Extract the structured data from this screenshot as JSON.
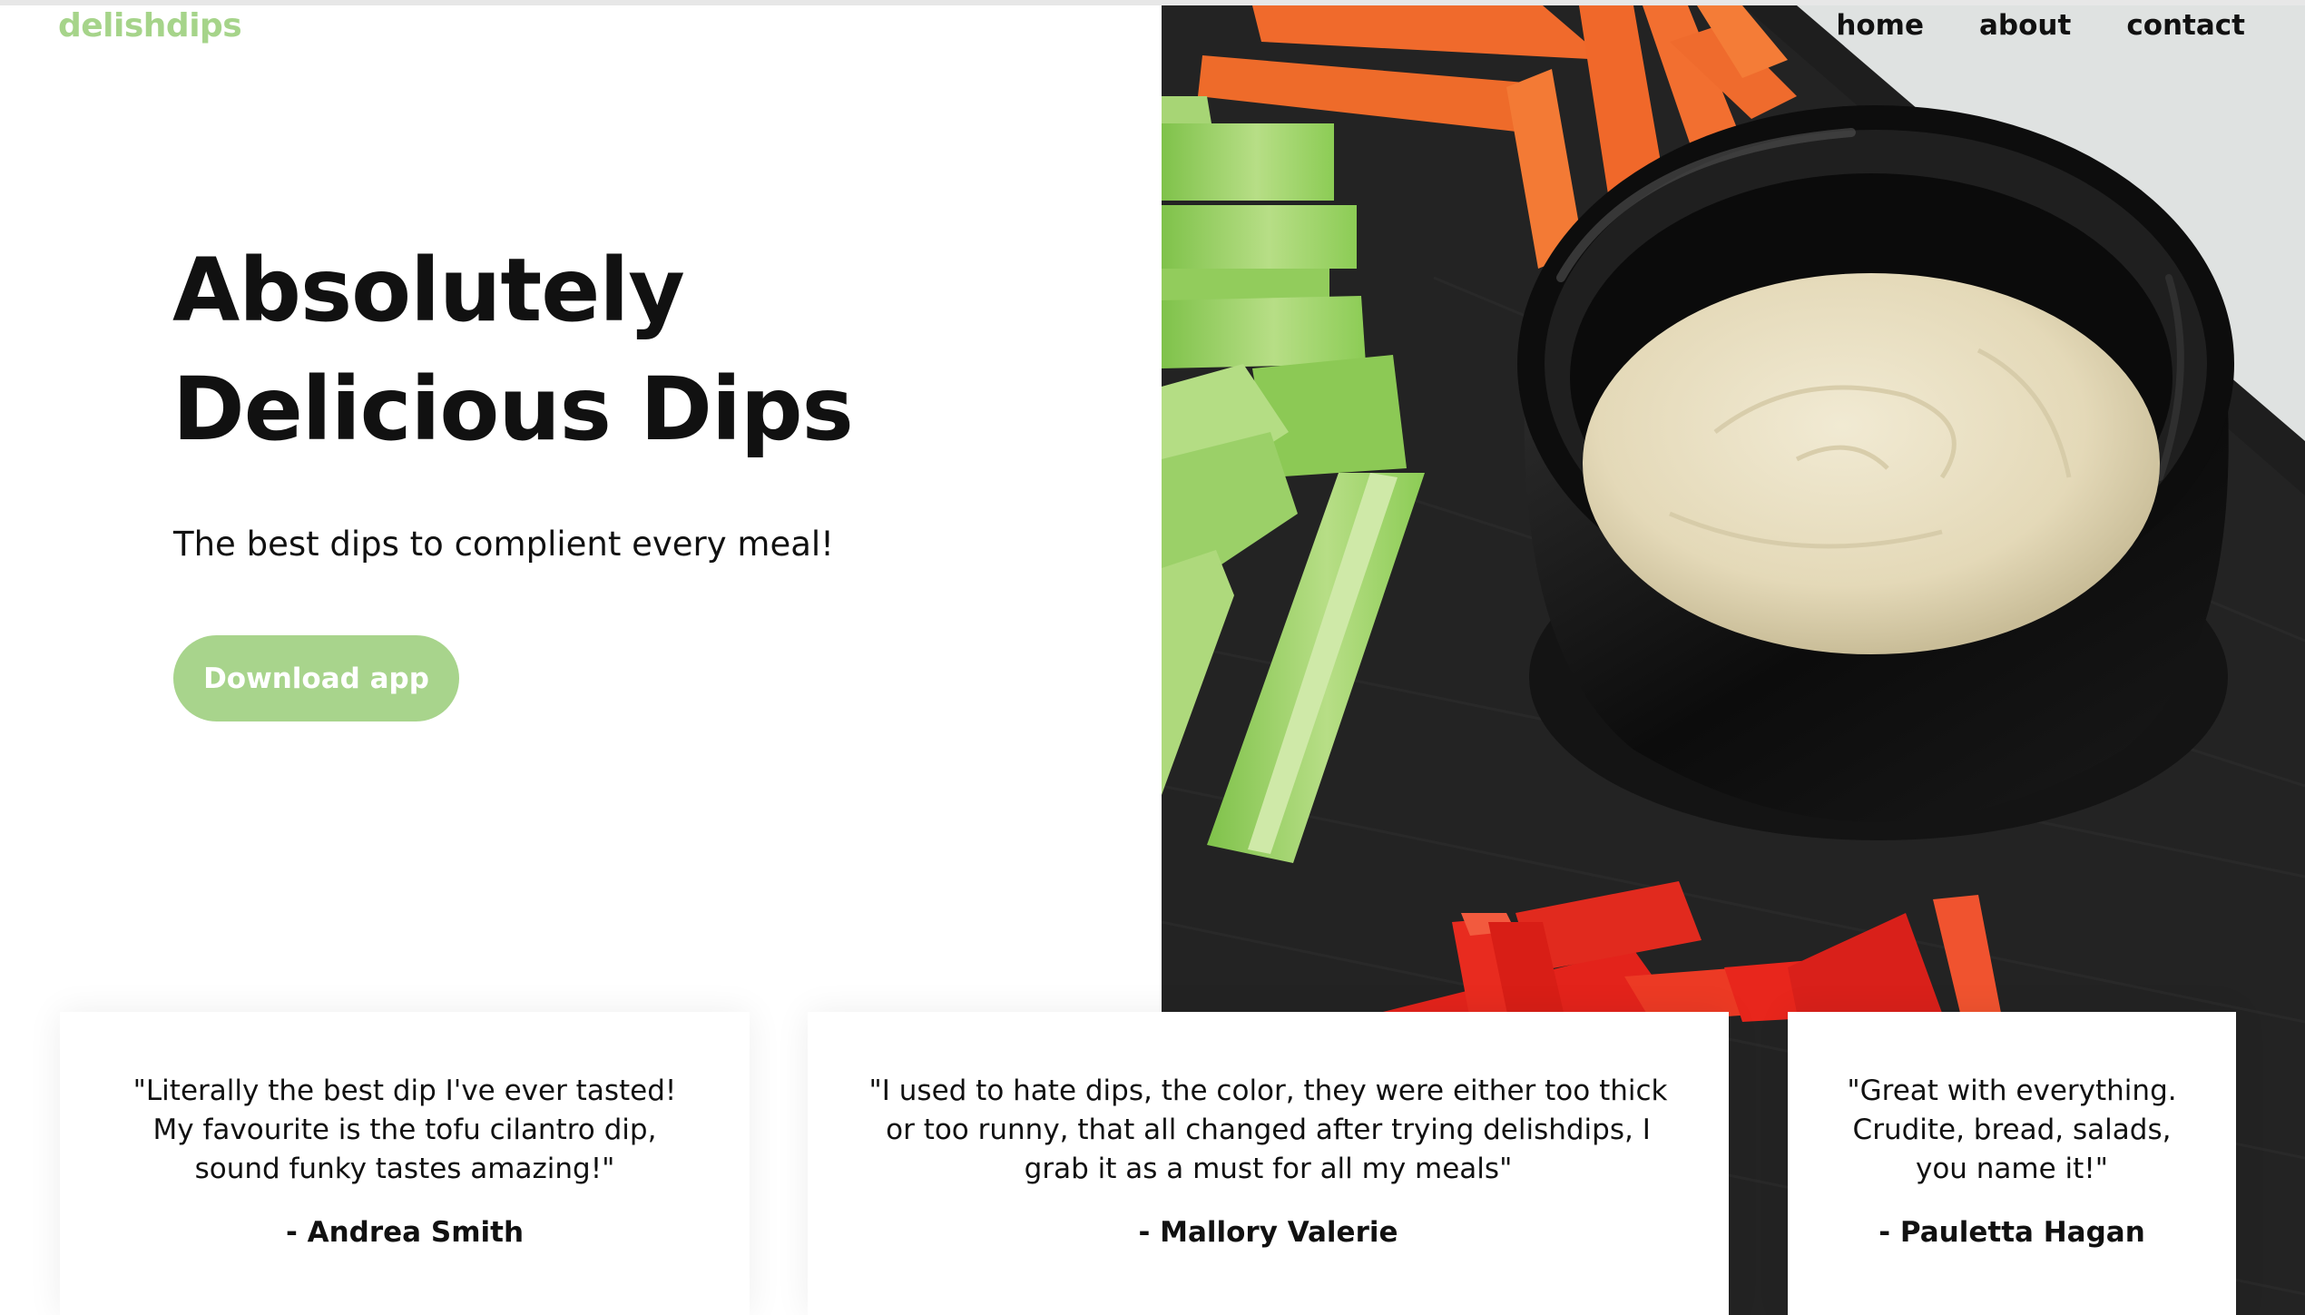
{
  "brand": {
    "name": "delishdips",
    "accent_color": "#a6d48a"
  },
  "nav": {
    "links": [
      {
        "label": "home"
      },
      {
        "label": "about"
      },
      {
        "label": "contact"
      }
    ]
  },
  "hero": {
    "title_line1": "Absolutely",
    "title_line2": "Delicious Dips",
    "subtitle": "The best dips to complient every meal!",
    "cta_label": "Download app",
    "cta_color": "#a8d48c",
    "image": "vegetable crudites with a bowl of cream dip"
  },
  "testimonials": [
    {
      "quote": "\"Literally the best dip I've ever tasted! My favourite is the tofu cilantro dip, sound funky tastes amazing!\"",
      "author": "- Andrea Smith"
    },
    {
      "quote": "\"I used to hate dips, the color, they were either too thick or too runny, that all changed after trying delishdips, I grab it as a must for all my meals\"",
      "author": "- Mallory Valerie"
    },
    {
      "quote": "\"Great with everything. Crudite, bread, salads, you name it!\"",
      "author": "- Pauletta Hagan"
    }
  ]
}
